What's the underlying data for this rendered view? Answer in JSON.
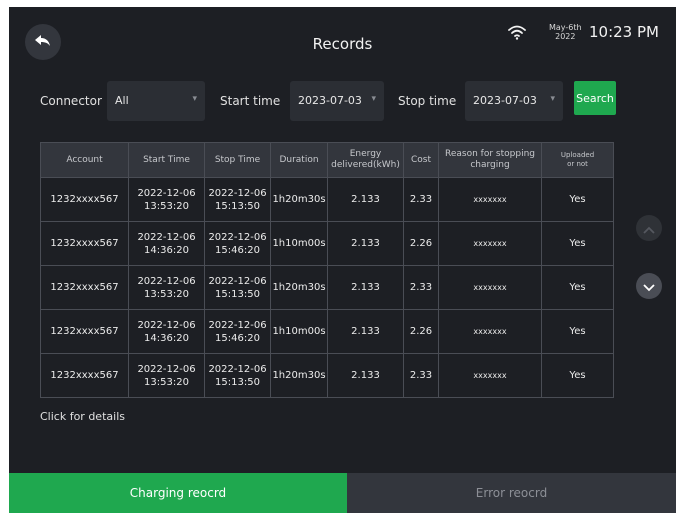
{
  "header": {
    "title": "Records",
    "date_month": "May-6th",
    "date_year": "2022",
    "time": "10:23 PM"
  },
  "filters": {
    "connector_label": "Connector",
    "connector_value": "All",
    "start_label": "Start time",
    "start_value": "2023-07-03",
    "stop_label": "Stop time",
    "stop_value": "2023-07-03",
    "search_label": "Search"
  },
  "table": {
    "headers": {
      "account": "Account",
      "start": "Start Time",
      "stop": "Stop Time",
      "duration": "Duration",
      "energy_line1": "Energy",
      "energy_line2": "delivered(kWh)",
      "cost": "Cost",
      "reason_line1": "Reason for stopping",
      "reason_line2": "charging",
      "uploaded_line1": "Uploaded",
      "uploaded_line2": "or not"
    },
    "rows": [
      {
        "account": "1232xxxx567",
        "start_date": "2022-12-06",
        "start_time": "13:53:20",
        "stop_date": "2022-12-06",
        "stop_time": "15:13:50",
        "duration": "1h20m30s",
        "energy": "2.133",
        "cost": "2.33",
        "reason": "xxxxxxx",
        "uploaded": "Yes"
      },
      {
        "account": "1232xxxx567",
        "start_date": "2022-12-06",
        "start_time": "14:36:20",
        "stop_date": "2022-12-06",
        "stop_time": "15:46:20",
        "duration": "1h10m00s",
        "energy": "2.133",
        "cost": "2.26",
        "reason": "xxxxxxx",
        "uploaded": "Yes"
      },
      {
        "account": "1232xxxx567",
        "start_date": "2022-12-06",
        "start_time": "13:53:20",
        "stop_date": "2022-12-06",
        "stop_time": "15:13:50",
        "duration": "1h20m30s",
        "energy": "2.133",
        "cost": "2.33",
        "reason": "xxxxxxx",
        "uploaded": "Yes"
      },
      {
        "account": "1232xxxx567",
        "start_date": "2022-12-06",
        "start_time": "14:36:20",
        "stop_date": "2022-12-06",
        "stop_time": "15:46:20",
        "duration": "1h10m00s",
        "energy": "2.133",
        "cost": "2.26",
        "reason": "xxxxxxx",
        "uploaded": "Yes"
      },
      {
        "account": "1232xxxx567",
        "start_date": "2022-12-06",
        "start_time": "13:53:20",
        "stop_date": "2022-12-06",
        "stop_time": "15:13:50",
        "duration": "1h20m30s",
        "energy": "2.133",
        "cost": "2.33",
        "reason": "xxxxxxx",
        "uploaded": "Yes"
      }
    ]
  },
  "footer": {
    "click_details": "Click for details",
    "tab_charging": "Charging reocrd",
    "tab_error": "Error reocrd"
  },
  "icons": {
    "back": "back-arrow-icon",
    "wifi": "wifi-icon",
    "scroll_up": "chevron-up-icon",
    "scroll_down": "chevron-down-icon",
    "dropdown": "caret-down-icon"
  },
  "colors": {
    "background": "#1d1f24",
    "accent": "#1fa84f",
    "panel": "#2b2e34",
    "header_cell": "#33363d"
  }
}
